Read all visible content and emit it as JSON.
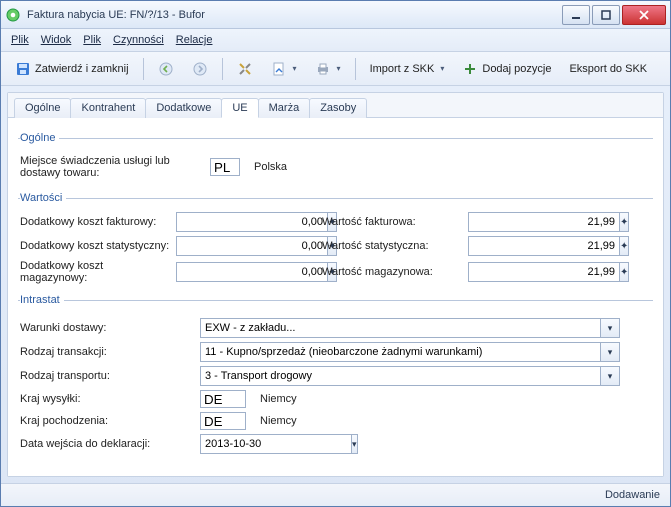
{
  "window": {
    "title": "Faktura nabycia UE: FN/?/13 - Bufor"
  },
  "menu": {
    "plik": "Plik",
    "widok": "Widok",
    "plik2": "Plik",
    "czynnosci": "Czynności",
    "relacje": "Relacje"
  },
  "toolbar": {
    "confirm_close": "Zatwierdź i zamknij",
    "import_skk": "Import z SKK",
    "add_positions": "Dodaj pozycje",
    "export_skk": "Eksport do SKK"
  },
  "tabs": {
    "ogolne": "Ogólne",
    "kontrahent": "Kontrahent",
    "dodatkowe": "Dodatkowe",
    "ue": "UE",
    "marza": "Marża",
    "zasoby": "Zasoby"
  },
  "ue_panel": {
    "group_ogolne": "Ogólne",
    "miejsce_label": "Miejsce świadczenia usługi lub dostawy towaru:",
    "miejsce_code": "PL",
    "miejsce_country": "Polska",
    "group_wartosci": "Wartości",
    "dod_fakturowy_label": "Dodatkowy koszt fakturowy:",
    "dod_fakturowy_value": "0,00",
    "wart_fakturowa_label": "Wartość fakturowa:",
    "wart_fakturowa_value": "21,99",
    "dod_statystyczny_label": "Dodatkowy koszt statystyczny:",
    "dod_statystyczny_value": "0,00",
    "wart_statystyczna_label": "Wartość statystyczna:",
    "wart_statystyczna_value": "21,99",
    "dod_magazynowy_label": "Dodatkowy koszt magazynowy:",
    "dod_magazynowy_value": "0,00",
    "wart_magazynowa_label": "Wartość magazynowa:",
    "wart_magazynowa_value": "21,99",
    "group_intrastat": "Intrastat",
    "warunki_label": "Warunki dostawy:",
    "warunki_value": "EXW - z zakładu...",
    "rodzaj_trans_label": "Rodzaj transakcji:",
    "rodzaj_trans_value": "11 - Kupno/sprzedaż (nieobarczone żadnymi warunkami)",
    "rodzaj_transportu_label": "Rodzaj transportu:",
    "rodzaj_transportu_value": "3 - Transport drogowy",
    "kraj_wysylki_label": "Kraj wysyłki:",
    "kraj_wysylki_code": "DE",
    "kraj_wysylki_country": "Niemcy",
    "kraj_pochodzenia_label": "Kraj pochodzenia:",
    "kraj_pochodzenia_code": "DE",
    "kraj_pochodzenia_country": "Niemcy",
    "data_deklaracji_label": "Data wejścia do deklaracji:",
    "data_deklaracji_value": "2013-10-30"
  },
  "status": {
    "mode": "Dodawanie"
  }
}
